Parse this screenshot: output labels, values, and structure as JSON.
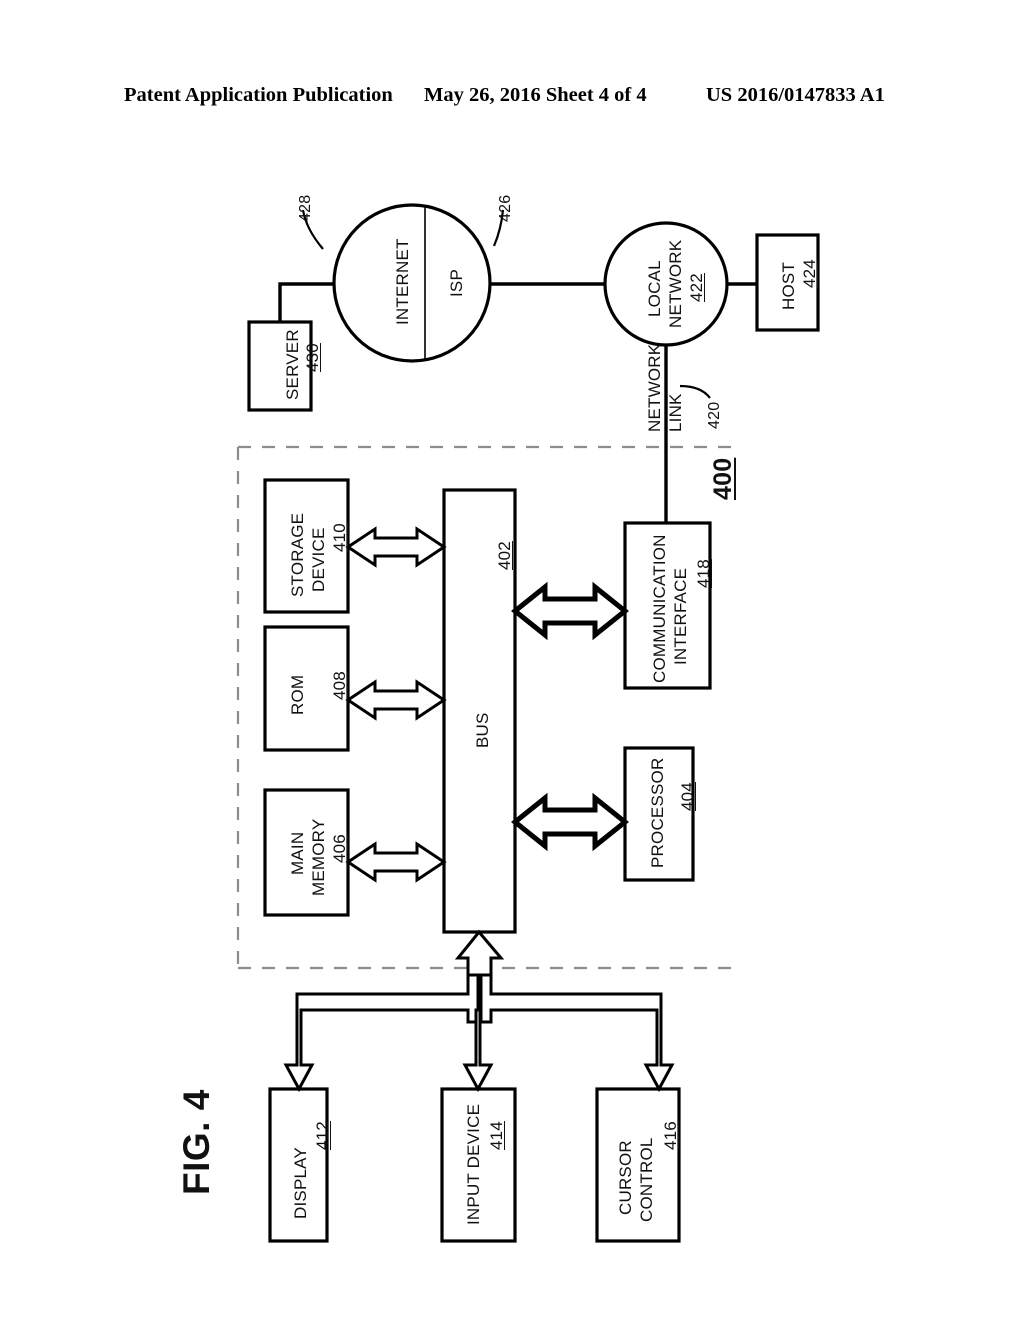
{
  "header": {
    "left": "Patent Application Publication",
    "middle": "May 26, 2016  Sheet 4 of 4",
    "right": "US 2016/0147833 A1"
  },
  "figure": {
    "title": "FIG. 4",
    "system_ref": "400"
  },
  "nodes": {
    "server": {
      "label": "SERVER",
      "ref": "430"
    },
    "internet": {
      "label": "INTERNET",
      "ref": "428"
    },
    "isp": {
      "label": "ISP",
      "ref": "426"
    },
    "local_network": {
      "label_line1": "LOCAL",
      "label_line2": "NETWORK",
      "ref": "422"
    },
    "host": {
      "label": "HOST",
      "ref": "424"
    },
    "network_link": {
      "label_line1": "NETWORK",
      "label_line2": "LINK",
      "ref": "420"
    },
    "storage_device": {
      "label_line1": "STORAGE",
      "label_line2": "DEVICE",
      "ref": "410"
    },
    "rom": {
      "label": "ROM",
      "ref": "408"
    },
    "main_memory": {
      "label_line1": "MAIN",
      "label_line2": "MEMORY",
      "ref": "406"
    },
    "bus": {
      "label": "BUS",
      "ref": "402"
    },
    "processor": {
      "label": "PROCESSOR",
      "ref": "404"
    },
    "communication_interface": {
      "label_line1": "COMMUNICATION",
      "label_line2": "INTERFACE",
      "ref": "418"
    },
    "display": {
      "label": "DISPLAY",
      "ref": "412"
    },
    "input_device": {
      "label": "INPUT DEVICE",
      "ref": "414"
    },
    "cursor_control": {
      "label_line1": "CURSOR",
      "label_line2": "CONTROL",
      "ref": "416"
    }
  },
  "colors": {
    "ink": "#000000",
    "dashed": "#8c8c8c",
    "paper": "#ffffff"
  }
}
